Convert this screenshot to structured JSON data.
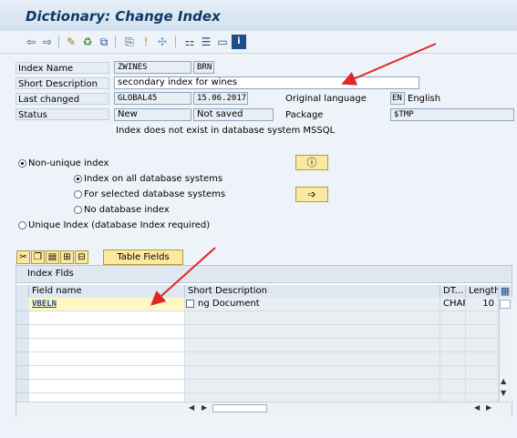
{
  "window": {
    "title": "Dictionary: Change Index"
  },
  "toolbar": {
    "icons": [
      "back-arrow-icon",
      "forward-arrow-icon",
      "display-change-icon",
      "activate-icon",
      "check-icon",
      "where-used-icon",
      "other-object-icon",
      "info-icon",
      "technical-settings-icon",
      "hierarchy-icon",
      "print-icon",
      "window-icon",
      "help-icon"
    ]
  },
  "form": {
    "index_name_label": "Index Name",
    "index_name_table": "ZWINES",
    "index_name_id": "BRN",
    "short_desc_label": "Short Description",
    "short_desc_value": "secondary index for wines",
    "last_changed_label": "Last changed",
    "last_changed_user": "GLOBAL45",
    "last_changed_date": "15.06.2017",
    "orig_lang_label": "Original language",
    "orig_lang_code": "EN",
    "orig_lang_name": "English",
    "status_label": "Status",
    "status_value": "New",
    "status_saved": "Not saved",
    "package_label": "Package",
    "package_value": "$TMP",
    "db_note": "Index does not exist in database system MSSQL"
  },
  "options": {
    "non_unique": "Non-unique index",
    "all_db": "Index on all database systems",
    "selected_db": "For selected database systems",
    "no_db": "No database index",
    "unique": "Unique Index (database Index required)"
  },
  "table_section": {
    "table_fields_button": "Table Fields",
    "group_title": "Index Flds",
    "columns": [
      "Field name",
      "Short Description",
      "DT...",
      "Length"
    ],
    "rows": [
      {
        "field": "VBELN",
        "desc": "ng Document",
        "dt": "CHAR",
        "len": "10"
      }
    ]
  },
  "colors": {
    "arrow": "#e0262a",
    "title_blue": "#0d3a67",
    "button_yellow": "#fce9a0"
  }
}
